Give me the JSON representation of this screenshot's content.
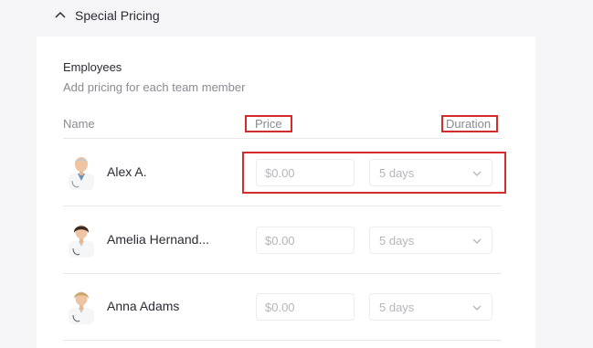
{
  "section": {
    "title": "Special Pricing"
  },
  "employees": {
    "heading": "Employees",
    "subtitle": "Add pricing for each team member",
    "columns": {
      "name": "Name",
      "price": "Price",
      "duration": "Duration"
    },
    "rows": [
      {
        "name": "Alex A.",
        "price_placeholder": "$0.00",
        "duration": "5 days"
      },
      {
        "name": "Amelia Hernand...",
        "price_placeholder": "$0.00",
        "duration": "5 days"
      },
      {
        "name": "Anna Adams",
        "price_placeholder": "$0.00",
        "duration": "5 days"
      }
    ]
  },
  "colors": {
    "highlight": "#d42b2b",
    "text": "#2b2b36",
    "muted": "#8a8a95",
    "placeholder": "#b5b5bd"
  },
  "icons": {
    "section_toggle": "chevron-up-icon",
    "select_arrow": "chevron-down-icon"
  }
}
